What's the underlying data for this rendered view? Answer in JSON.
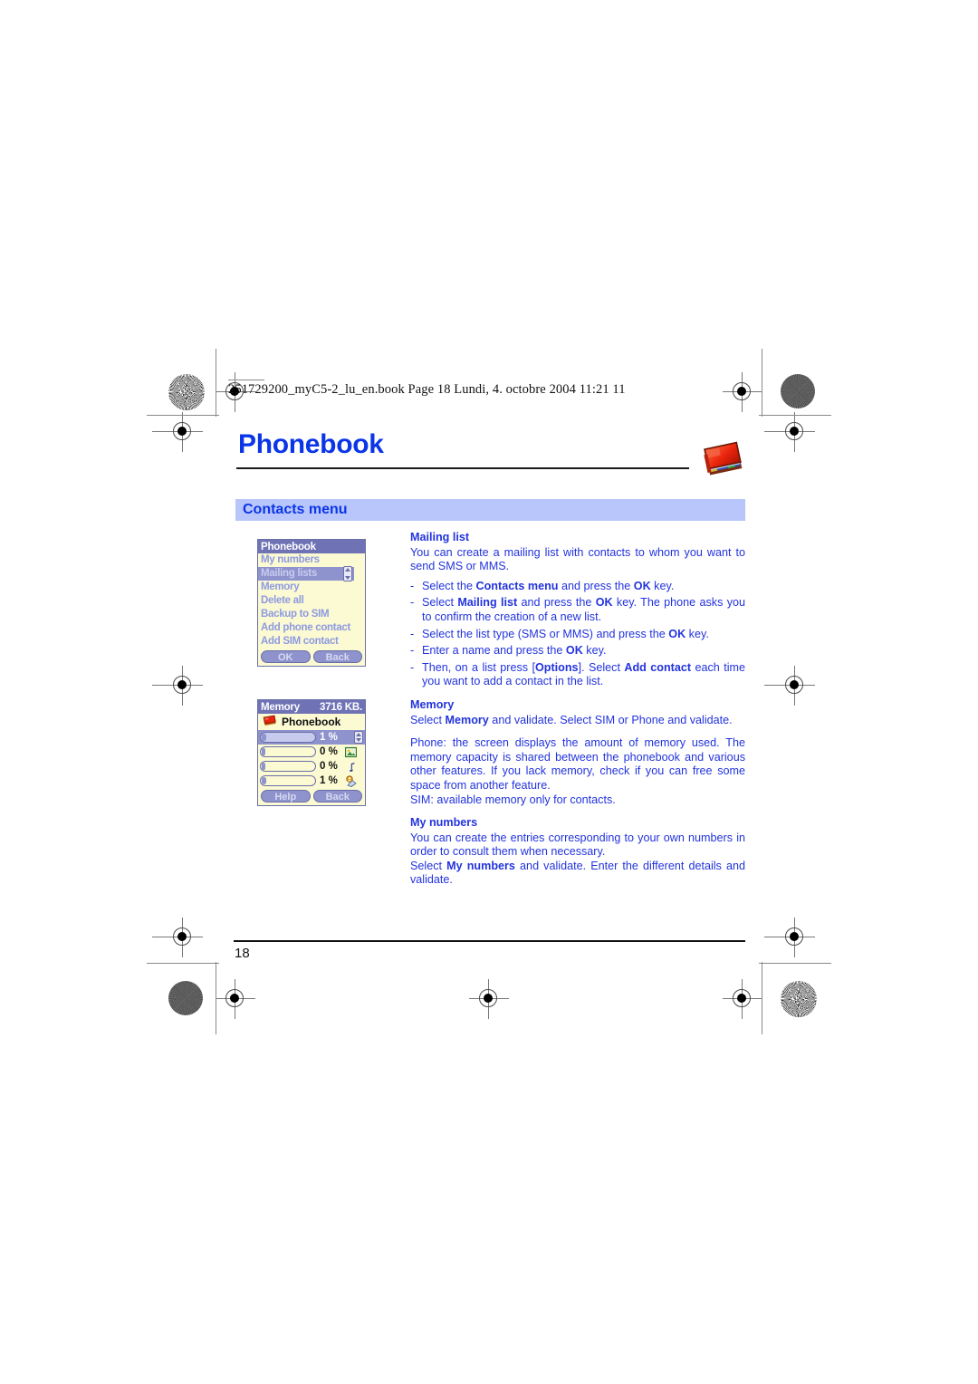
{
  "page": {
    "book_header": "251729200_myC5-2_lu_en.book  Page 18  Lundi, 4. octobre 2004  11:21 11",
    "chapter_title": "Phonebook",
    "section_banner": "Contacts menu",
    "page_number": "18",
    "accent_color": "#2233dd",
    "title_color": "#0b35e8",
    "banner_bg": "#b8c6fb"
  },
  "icons": {
    "chapter": "phonebook-book-icon",
    "phonebook_small": "book-icon",
    "picture": "picture-icon",
    "music": "music-note-icon",
    "contacts": "contacts-icon"
  },
  "phone_menu": {
    "title": "Phonebook",
    "items": [
      {
        "label": "My numbers",
        "selected": false
      },
      {
        "label": "Mailing lists",
        "selected": true
      },
      {
        "label": "Memory",
        "selected": false
      },
      {
        "label": "Delete all",
        "selected": false
      },
      {
        "label": "Backup to SIM",
        "selected": false
      },
      {
        "label": "Add phone contact",
        "selected": false
      },
      {
        "label": "Add SIM contact",
        "selected": false
      }
    ],
    "softkey_left": "OK",
    "softkey_right": "Back"
  },
  "phone_memory": {
    "title": "Memory",
    "capacity": "3716 KB.",
    "category": "Phonebook",
    "rows": [
      {
        "percent": "1 %",
        "fill": 1,
        "icon": "",
        "selected": true
      },
      {
        "percent": "0 %",
        "fill": 0,
        "icon": "picture-icon",
        "selected": false
      },
      {
        "percent": "0 %",
        "fill": 0,
        "icon": "music-note-icon",
        "selected": false
      },
      {
        "percent": "1 %",
        "fill": 1,
        "icon": "contacts-icon",
        "selected": false
      }
    ],
    "softkey_left": "Help",
    "softkey_right": "Back"
  },
  "content": {
    "mailing_list": {
      "heading": "Mailing list",
      "intro": "You can create a mailing list with contacts to whom you want to send SMS or MMS.",
      "bullets": [
        {
          "pre": "Select the ",
          "b1": "Contacts menu",
          "mid": " and press the ",
          "b2": "OK",
          "post": " key."
        },
        {
          "pre": "Select ",
          "b1": "Mailing list",
          "mid": " and press the ",
          "b2": "OK",
          "post": " key. The phone asks you to confirm the creation of a new list."
        },
        {
          "pre": "Select the list type (SMS or MMS) and press the ",
          "b1": "",
          "mid": "",
          "b2": "OK",
          "post": " key."
        },
        {
          "pre": "Enter a name and press the ",
          "b1": "",
          "mid": "",
          "b2": "OK",
          "post": " key."
        },
        {
          "pre": "Then, on a list press [",
          "b1": "Options",
          "mid": "]. Select ",
          "b2": "Add contact",
          "post": " each time you want to add a contact in the list."
        }
      ]
    },
    "memory": {
      "heading": "Memory",
      "line1_pre": "Select ",
      "line1_b": "Memory",
      "line1_post": " and validate. Select SIM or Phone and validate.",
      "para": "Phone: the screen displays the amount of memory used. The memory capacity is shared between the phonebook and various other features. If you lack memory, check if you can free some space from another feature.",
      "sim_line": "SIM: available memory only for contacts."
    },
    "my_numbers": {
      "heading": "My numbers",
      "para1": "You can create the entries corresponding to your own numbers in order to consult them when necessary.",
      "para2_pre": "Select ",
      "para2_b": "My numbers",
      "para2_post": " and validate. Enter the different details and validate."
    }
  }
}
